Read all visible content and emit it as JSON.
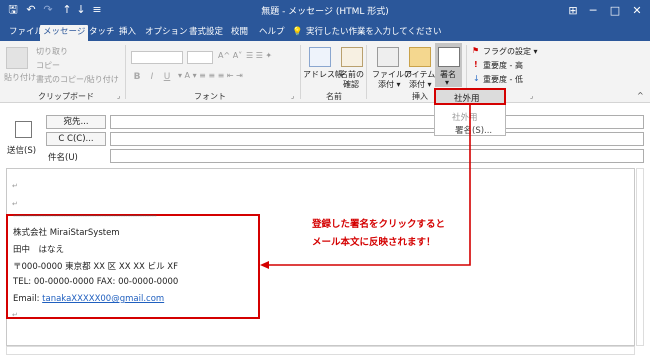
{
  "titlebar": {
    "title": "無題 - メッセージ (HTML 形式)",
    "icons": [
      "save-icon",
      "undo-icon",
      "redo-icon",
      "up-icon",
      "down-icon",
      "customize-icon"
    ],
    "window_controls": [
      "ribbon-display-icon",
      "minimize-icon",
      "maximize-icon",
      "close-icon"
    ]
  },
  "tabs": [
    {
      "label": "ファイル"
    },
    {
      "label": "メッセージ",
      "active": true
    },
    {
      "label": "タッチ"
    },
    {
      "label": "挿入"
    },
    {
      "label": "オプション"
    },
    {
      "label": "書式設定"
    },
    {
      "label": "校閲"
    },
    {
      "label": "ヘルプ"
    }
  ],
  "tell_me": "実行したい作業を入力してください",
  "ribbon": {
    "clipboard": {
      "paste": "貼り付け",
      "cut": "切り取り",
      "copy": "コピー",
      "format_painter": "書式のコピー/貼り付け",
      "label": "クリップボード"
    },
    "font": {
      "label": "フォント",
      "bold": "B",
      "italic": "I",
      "underline": "U"
    },
    "names": {
      "address_book": "アドレス帳",
      "check_names_1": "名前の",
      "check_names_2": "確認",
      "label": "名前"
    },
    "insert": {
      "attach_file_1": "ファイルの",
      "attach_file_2": "添付 ▾",
      "attach_item_1": "アイテムの",
      "attach_item_2": "添付 ▾",
      "signature": "署名",
      "signature_arrow": "▾",
      "label": "挿入"
    },
    "tags": {
      "follow_up": "フラグの設定 ▾",
      "high_importance": "重要度 - 高",
      "low_importance": "重要度 - 低"
    }
  },
  "signature_menu": {
    "items": [
      "社外用",
      "社外用",
      "署名(S)..."
    ]
  },
  "header": {
    "send": "送信(S)",
    "to": "宛先...",
    "cc": "C C(C)...",
    "subject": "件名(U)"
  },
  "signature": {
    "separator": "------------------------------------------------------------",
    "company": "株式会社 MiraiStarSystem",
    "name": "田中　はなえ",
    "address": "〒000-0000 東京都 XX 区 XX XX ビル XF",
    "phone": "TEL: 00-0000-0000 FAX: 00-0000-0000",
    "email_label": "Email: ",
    "email": "tanakaXXXXX00@gmail.com"
  },
  "annotation": {
    "line1": "登録した署名をクリックすると",
    "line2": "メール本文に反映されます！"
  },
  "colors": {
    "titlebar": "#2b579a",
    "annotation": "#d40000",
    "link": "#1f5fbf"
  }
}
